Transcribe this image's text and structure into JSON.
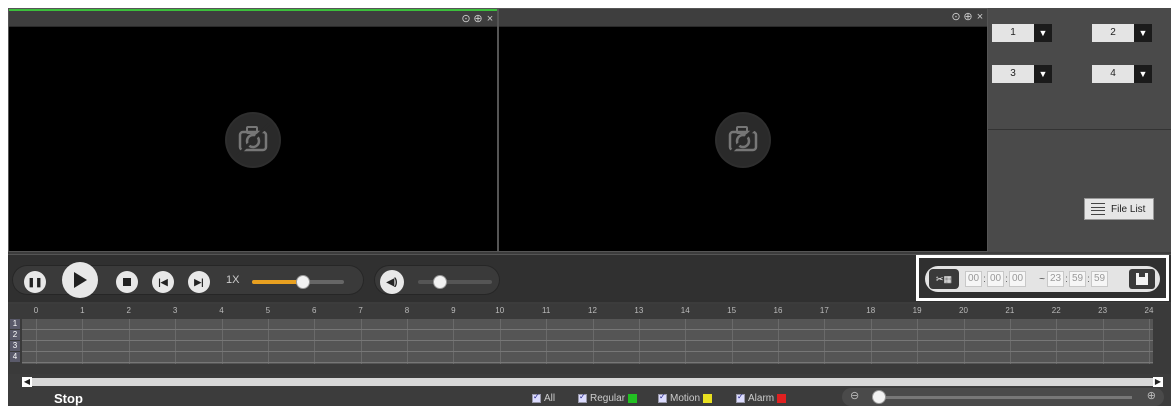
{
  "panes": [
    {
      "controls": [
        "⊙",
        "⊕",
        "×"
      ]
    },
    {
      "controls": [
        "⊙",
        "⊕",
        "×"
      ]
    }
  ],
  "right_panel": {
    "selectors": [
      {
        "value": "1"
      },
      {
        "value": "2"
      },
      {
        "value": "3"
      },
      {
        "value": "4"
      }
    ],
    "file_list_label": "File List"
  },
  "playback": {
    "speed_label": "1X",
    "progress_level": 0.55,
    "volume_level": 0.3
  },
  "clip": {
    "start": [
      "00",
      "00",
      "00"
    ],
    "separator": "~",
    "end": [
      "23",
      "59",
      "59"
    ]
  },
  "timeline": {
    "hours": [
      "0",
      "1",
      "2",
      "3",
      "4",
      "5",
      "6",
      "7",
      "8",
      "9",
      "10",
      "11",
      "12",
      "13",
      "14",
      "15",
      "16",
      "17",
      "18",
      "19",
      "20",
      "21",
      "22",
      "23",
      "24"
    ],
    "channels": [
      "1",
      "2",
      "3",
      "4"
    ]
  },
  "footer": {
    "status": "Stop",
    "legend": [
      {
        "label": "All",
        "color": ""
      },
      {
        "label": "Regular",
        "color": "#22c022"
      },
      {
        "label": "Motion",
        "color": "#e8e020"
      },
      {
        "label": "Alarm",
        "color": "#e02020"
      }
    ]
  },
  "colors": {
    "selected_border": "#3cbf3c",
    "speed_fill": "#e8a020"
  }
}
